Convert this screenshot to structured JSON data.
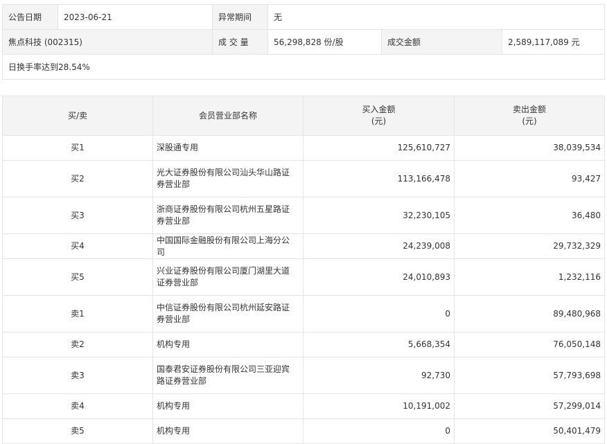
{
  "info": {
    "date_label": "公告日期",
    "date_value": "2023-06-21",
    "period_label": "异常期间",
    "period_value": "无",
    "stock": "焦点科技 (002315)",
    "volume_label": "成 交 量",
    "volume_value": "56,298,828 份/股",
    "amount_label": "成交金额",
    "amount_value": "2,589,117,089 元",
    "reason": "日换手率达到28.54%"
  },
  "table": {
    "headers": {
      "side": "买/卖",
      "name": "会员营业部名称",
      "buy": "买入金额",
      "buy_unit": "(元)",
      "sell": "卖出金额",
      "sell_unit": "(元)"
    },
    "rows": [
      {
        "side": "买1",
        "name": "深股通专用",
        "buy": "125,610,727",
        "sell": "38,039,534"
      },
      {
        "side": "买2",
        "name": "光大证券股份有限公司汕头华山路证券营业部",
        "buy": "113,166,478",
        "sell": "93,427"
      },
      {
        "side": "买3",
        "name": "浙商证券股份有限公司杭州五星路证券营业部",
        "buy": "32,230,105",
        "sell": "36,480"
      },
      {
        "side": "买4",
        "name": "中国国际金融股份有限公司上海分公司",
        "buy": "24,239,008",
        "sell": "29,732,329"
      },
      {
        "side": "买5",
        "name": "兴业证券股份有限公司厦门湖里大道证券营业部",
        "buy": "24,010,893",
        "sell": "1,232,116"
      },
      {
        "side": "卖1",
        "name": "中信证券股份有限公司杭州延安路证券营业部",
        "buy": "0",
        "sell": "89,480,968"
      },
      {
        "side": "卖2",
        "name": "机构专用",
        "buy": "5,668,354",
        "sell": "76,050,148"
      },
      {
        "side": "卖3",
        "name": "国泰君安证券股份有限公司三亚迎宾路证券营业部",
        "buy": "92,730",
        "sell": "57,793,698"
      },
      {
        "side": "卖4",
        "name": "机构专用",
        "buy": "10,191,002",
        "sell": "57,299,014"
      },
      {
        "side": "卖5",
        "name": "机构专用",
        "buy": "0",
        "sell": "50,401,479"
      }
    ]
  }
}
